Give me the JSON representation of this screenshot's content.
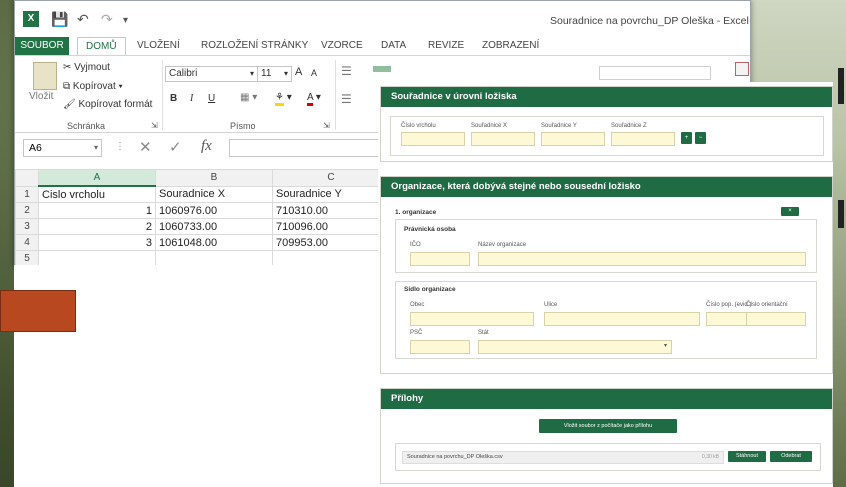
{
  "excel": {
    "window_title": "Souradnice na povrchu_DP Oleška - Excel",
    "logo_text": "X",
    "qat": {
      "save_icon": "save-icon",
      "undo_icon": "undo-icon",
      "redo_icon": "redo-icon"
    },
    "tabs": [
      "SOUBOR",
      "DOMŮ",
      "VLOŽENÍ",
      "ROZLOŽENÍ STRÁNKY",
      "VZORCE",
      "DATA",
      "REVIZE",
      "ZOBRAZENÍ"
    ],
    "ribbon": {
      "paste": "Vložit",
      "cut": "Vyjmout",
      "copy": "Kopírovat",
      "format_painter": "Kopírovat formát",
      "clipboard_group": "Schránka",
      "font_name": "Calibri",
      "font_size": "11",
      "bold": "B",
      "italic": "I",
      "underline": "U",
      "font_group": "Písmo",
      "grow_font": "A",
      "shrink_font": "A"
    },
    "name_box": "A6",
    "fx": "fx",
    "columns": [
      "A",
      "B",
      "C"
    ],
    "row_numbers": [
      "1",
      "2",
      "3",
      "4",
      "5"
    ],
    "rows": [
      [
        "Cislo vrcholu",
        "Souradnice X",
        "Souradnice Y"
      ],
      [
        "1",
        "1060976.00",
        "710310.00"
      ],
      [
        "2",
        "1060733.00",
        "710096.00"
      ],
      [
        "3",
        "1061048.00",
        "709953.00"
      ],
      [
        "",
        "",
        ""
      ]
    ]
  },
  "form": {
    "panel1": {
      "title": "Souřadnice v úrovni ložiska",
      "labels": [
        "Číslo vrcholu",
        "Souřadnice X",
        "Souřadnice Y",
        "Souřadnice Z"
      ],
      "add_button": "+",
      "remove_button": "−"
    },
    "panel2": {
      "title": "Organizace, která dobývá stejné nebo sousední ložisko",
      "org_heading": "1. organizace",
      "remove_org_button": "×",
      "legal_heading": "Právnická osoba",
      "ico_label": "IČO",
      "name_label": "Název organizace",
      "seat_heading": "Sídlo organizace",
      "obec_label": "Obec",
      "ulice_label": "Ulice",
      "cp_label": "Číslo pop. (evid.)",
      "co_label": "Číslo orientační",
      "psc_label": "PSČ",
      "stat_label": "Stát"
    },
    "panel3": {
      "title": "Přílohy",
      "upload_button": "Vložit soubor z počítače jako přílohu",
      "file_name": "Souradnice na povrchu_DP Oleška.csv",
      "file_size": "0,30 kB",
      "download_button": "Stáhnout",
      "delete_button": "Odebrat"
    }
  }
}
